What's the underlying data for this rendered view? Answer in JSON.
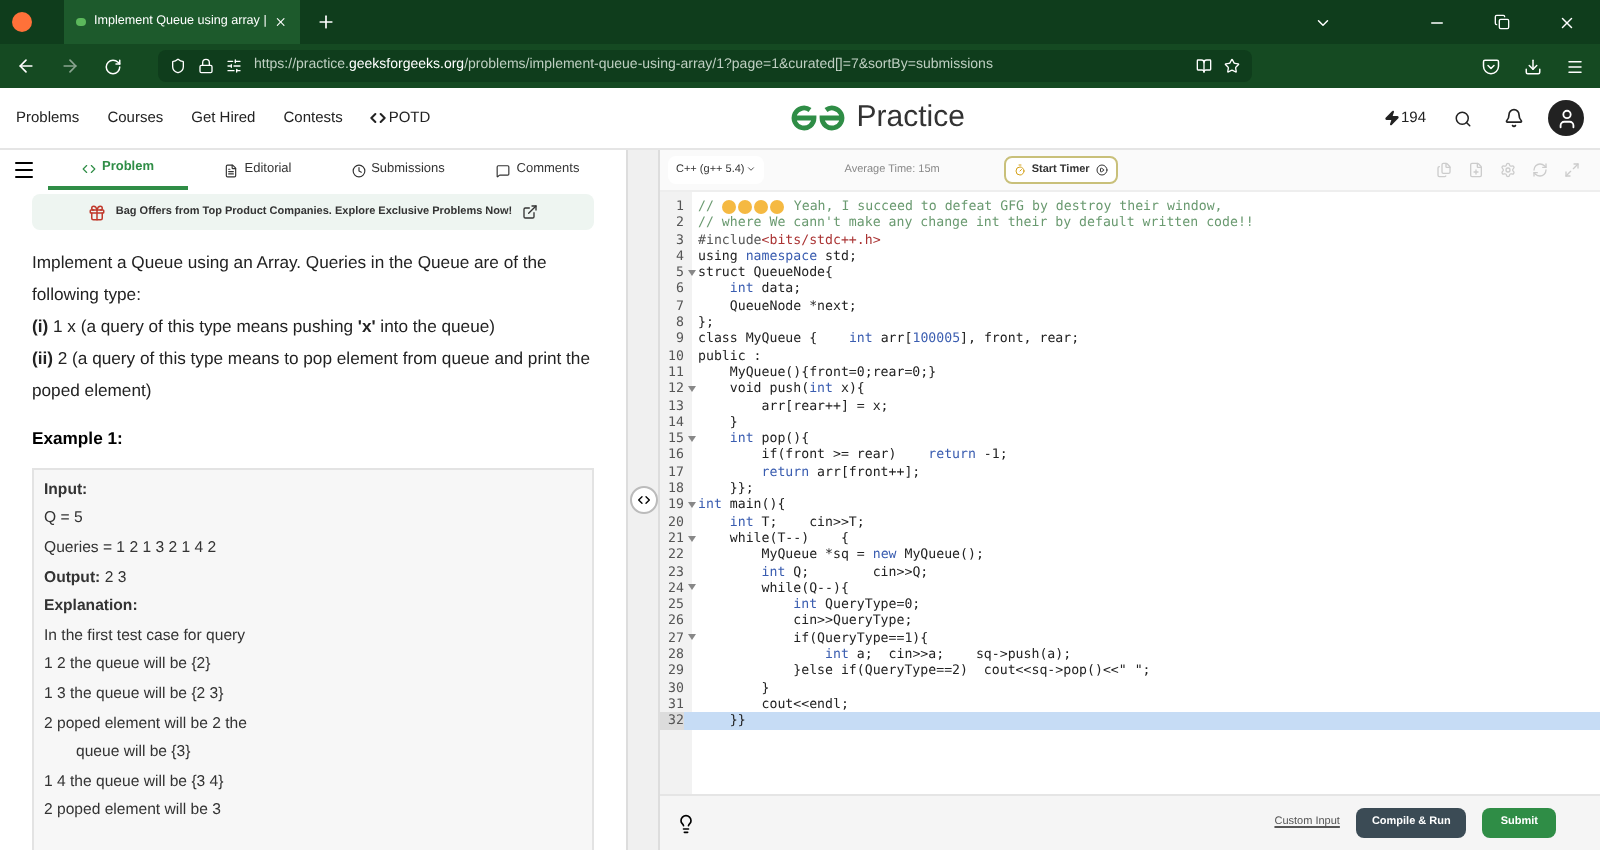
{
  "browser": {
    "tab_title": "Implement Queue using array |",
    "url_prefix": "https://practice.",
    "url_domain": "geeksforgeeks.org",
    "url_path": "/problems/implement-queue-using-array/1?page=1&curated[]=7&sortBy=submissions"
  },
  "site_nav": {
    "links": [
      "Problems",
      "Courses",
      "Get Hired",
      "Contests",
      "POTD"
    ],
    "logo_text": "Practice",
    "streak": "194"
  },
  "problem_tabs": [
    {
      "label": "Problem",
      "selected": true
    },
    {
      "label": "Editorial",
      "selected": false
    },
    {
      "label": "Submissions",
      "selected": false
    },
    {
      "label": "Comments",
      "selected": false
    }
  ],
  "banner": "Bag Offers from Top Product Companies. Explore Exclusive Problems Now!",
  "statement": [
    "Implement a Queue using an Array. Queries in the Queue are of the following type:",
    "**(i)** 1 x   (a query of this type means  pushing **'x'** into the queue)",
    "**(ii)** 2   (a query of this type means to pop element from queue and print the poped element)"
  ],
  "example_title": "Example 1:",
  "example_lines": [
    {
      "text": "Input:",
      "kind": "head"
    },
    {
      "text": "Q = 5",
      "kind": "plain"
    },
    {
      "text": "Queries = 1 2 1 3 2 1 4 2",
      "kind": "plain"
    },
    {
      "text": "**Output:** 2 3",
      "kind": "plain"
    },
    {
      "text": "Explanation:",
      "kind": "head"
    },
    {
      "text": "In the first test case for query",
      "kind": "plain"
    },
    {
      "text": "1 2 the queue will be {2}",
      "kind": "plain"
    },
    {
      "text": "1 3 the queue will be {2 3}",
      "kind": "plain"
    },
    {
      "text": "2    poped element will be 2 the",
      "kind": "plain"
    },
    {
      "text": "queue will be {3}",
      "kind": "indent"
    },
    {
      "text": "1 4 the queue will be {3 4}",
      "kind": "plain"
    },
    {
      "text": "2    poped element will be 3",
      "kind": "plain"
    }
  ],
  "editor": {
    "language": "C++ (g++ 5.4)",
    "average_time": "Average Time: 15m",
    "timer_button": "Start Timer",
    "lines": [
      {
        "n": "1",
        "fold": false,
        "selected": false,
        "seg": [
          {
            "kind": "comment",
            "text": "// "
          },
          {
            "kind": "emoji"
          },
          {
            "kind": "emoji"
          },
          {
            "kind": "emoji"
          },
          {
            "kind": "emoji"
          },
          {
            "kind": "comment",
            "text": " Yeah, I succeed to defeat GFG by destroy their window,"
          }
        ]
      },
      {
        "n": "2",
        "fold": false,
        "selected": false,
        "seg": [
          {
            "kind": "comment",
            "text": "// where We cann't make any change int their by default written code!!"
          }
        ]
      },
      {
        "n": "3",
        "fold": false,
        "selected": false,
        "seg": [
          {
            "kind": "pre",
            "text": "#include"
          },
          {
            "kind": "str",
            "text": "<bits/stdc++.h>"
          }
        ]
      },
      {
        "n": "4",
        "fold": false,
        "selected": false,
        "seg": [
          {
            "kind": "plain",
            "text": "using "
          },
          {
            "kind": "kw",
            "text": "namespace"
          },
          {
            "kind": "plain",
            "text": " std;"
          }
        ]
      },
      {
        "n": "5",
        "fold": true,
        "selected": false,
        "seg": [
          {
            "kind": "plain",
            "text": "struct QueueNode{"
          }
        ]
      },
      {
        "n": "6",
        "fold": false,
        "selected": false,
        "seg": [
          {
            "kind": "kw",
            "text": "    int"
          },
          {
            "kind": "plain",
            "text": " data;"
          }
        ]
      },
      {
        "n": "7",
        "fold": false,
        "selected": false,
        "seg": [
          {
            "kind": "plain",
            "text": "    QueueNode *next;"
          }
        ]
      },
      {
        "n": "8",
        "fold": false,
        "selected": false,
        "seg": [
          {
            "kind": "plain",
            "text": "};"
          }
        ]
      },
      {
        "n": "9",
        "fold": false,
        "selected": false,
        "seg": [
          {
            "kind": "plain",
            "text": "class MyQueue {    "
          },
          {
            "kind": "kw",
            "text": "int"
          },
          {
            "kind": "plain",
            "text": " arr["
          },
          {
            "kind": "num",
            "text": "100005"
          },
          {
            "kind": "plain",
            "text": "], front, rear;"
          }
        ]
      },
      {
        "n": "10",
        "fold": false,
        "selected": false,
        "seg": [
          {
            "kind": "plain",
            "text": "public :"
          }
        ]
      },
      {
        "n": "11",
        "fold": false,
        "selected": false,
        "seg": [
          {
            "kind": "plain",
            "text": "    MyQueue(){front=0;rear=0;}"
          }
        ]
      },
      {
        "n": "12",
        "fold": true,
        "selected": false,
        "seg": [
          {
            "kind": "plain",
            "text": "    void push("
          },
          {
            "kind": "kw",
            "text": "int"
          },
          {
            "kind": "plain",
            "text": " x){"
          }
        ]
      },
      {
        "n": "13",
        "fold": false,
        "selected": false,
        "seg": [
          {
            "kind": "plain",
            "text": "        arr[rear++] = x;"
          }
        ]
      },
      {
        "n": "14",
        "fold": false,
        "selected": false,
        "seg": [
          {
            "kind": "plain",
            "text": "    }"
          }
        ]
      },
      {
        "n": "15",
        "fold": true,
        "selected": false,
        "seg": [
          {
            "kind": "kw",
            "text": "    int"
          },
          {
            "kind": "plain",
            "text": " pop(){"
          }
        ]
      },
      {
        "n": "16",
        "fold": false,
        "selected": false,
        "seg": [
          {
            "kind": "plain",
            "text": "        if(front >= rear)    "
          },
          {
            "kind": "kw",
            "text": "return"
          },
          {
            "kind": "plain",
            "text": " -1;"
          }
        ]
      },
      {
        "n": "17",
        "fold": false,
        "selected": false,
        "seg": [
          {
            "kind": "kw",
            "text": "        return"
          },
          {
            "kind": "plain",
            "text": " arr[front++];"
          }
        ]
      },
      {
        "n": "18",
        "fold": false,
        "selected": false,
        "seg": [
          {
            "kind": "plain",
            "text": "    }};"
          }
        ]
      },
      {
        "n": "19",
        "fold": true,
        "selected": false,
        "seg": [
          {
            "kind": "kw",
            "text": "int"
          },
          {
            "kind": "plain",
            "text": " main(){"
          }
        ]
      },
      {
        "n": "20",
        "fold": false,
        "selected": false,
        "seg": [
          {
            "kind": "kw",
            "text": "    int"
          },
          {
            "kind": "plain",
            "text": " T;    cin>>T;"
          }
        ]
      },
      {
        "n": "21",
        "fold": true,
        "selected": false,
        "seg": [
          {
            "kind": "plain",
            "text": "    while(T--)    {"
          }
        ]
      },
      {
        "n": "22",
        "fold": false,
        "selected": false,
        "seg": [
          {
            "kind": "plain",
            "text": "        MyQueue *sq = "
          },
          {
            "kind": "kw",
            "text": "new"
          },
          {
            "kind": "plain",
            "text": " MyQueue();"
          }
        ]
      },
      {
        "n": "23",
        "fold": false,
        "selected": false,
        "seg": [
          {
            "kind": "kw",
            "text": "        int"
          },
          {
            "kind": "plain",
            "text": " Q;        cin>>Q;"
          }
        ]
      },
      {
        "n": "24",
        "fold": true,
        "selected": false,
        "seg": [
          {
            "kind": "plain",
            "text": "        while(Q--){"
          }
        ]
      },
      {
        "n": "25",
        "fold": false,
        "selected": false,
        "seg": [
          {
            "kind": "kw",
            "text": "            int"
          },
          {
            "kind": "plain",
            "text": " QueryType=0;"
          }
        ]
      },
      {
        "n": "26",
        "fold": false,
        "selected": false,
        "seg": [
          {
            "kind": "plain",
            "text": "            cin>>QueryType;"
          }
        ]
      },
      {
        "n": "27",
        "fold": true,
        "selected": false,
        "seg": [
          {
            "kind": "plain",
            "text": "            if(QueryType==1){"
          }
        ]
      },
      {
        "n": "28",
        "fold": false,
        "selected": false,
        "seg": [
          {
            "kind": "kw",
            "text": "                int"
          },
          {
            "kind": "plain",
            "text": " a;  cin>>a;    sq->push(a);"
          }
        ]
      },
      {
        "n": "29",
        "fold": false,
        "selected": false,
        "seg": [
          {
            "kind": "plain",
            "text": "            }else if(QueryType==2)  cout<<sq->pop()<<\" \";"
          }
        ]
      },
      {
        "n": "30",
        "fold": false,
        "selected": false,
        "seg": [
          {
            "kind": "plain",
            "text": "        }"
          }
        ]
      },
      {
        "n": "31",
        "fold": false,
        "selected": false,
        "seg": [
          {
            "kind": "plain",
            "text": "        cout<<endl;"
          }
        ]
      },
      {
        "n": "32",
        "fold": false,
        "selected": true,
        "seg": [
          {
            "kind": "plain",
            "text": "    }}"
          }
        ]
      }
    ],
    "custom_input": "Custom Input",
    "compile_button": "Compile & Run",
    "submit_button": "Submit"
  }
}
